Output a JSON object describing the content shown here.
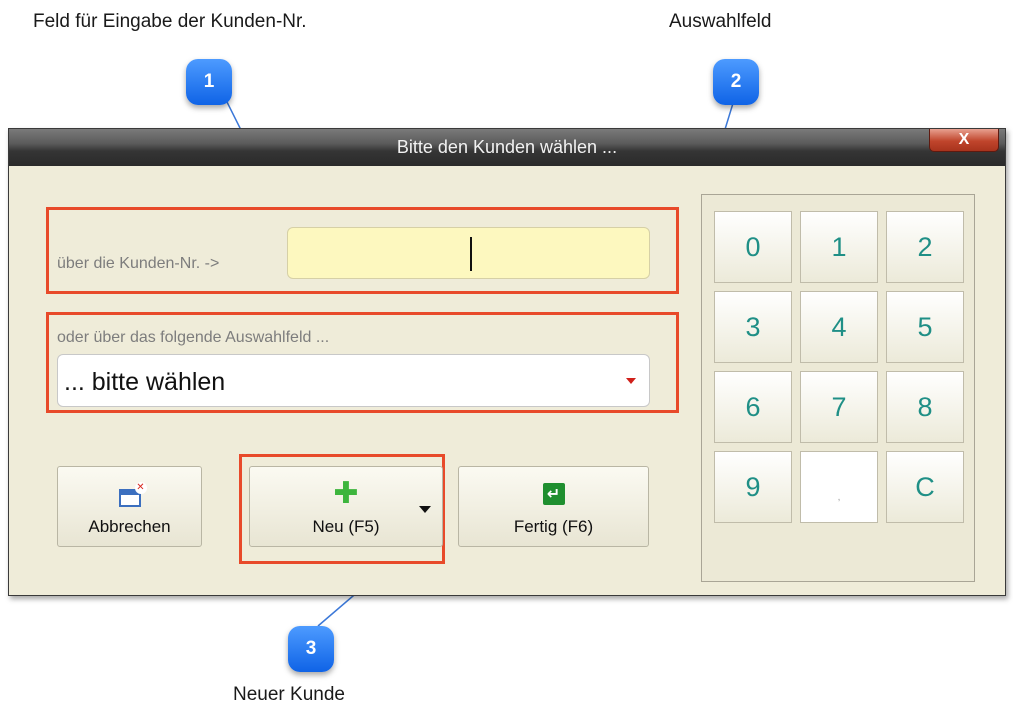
{
  "callouts": [
    {
      "number": "1",
      "label": "Feld für Eingabe der Kunden-Nr."
    },
    {
      "number": "2",
      "label": "Auswahlfeld"
    },
    {
      "number": "3",
      "label": "Neuer Kunde"
    }
  ],
  "window": {
    "title": "Bitte den Kunden wählen ...",
    "close_label": "X"
  },
  "customer_number": {
    "label": "über die Kunden-Nr. ->",
    "value": ""
  },
  "selection": {
    "label": "oder über das folgende Auswahlfeld ...",
    "selected": "... bitte wählen"
  },
  "buttons": {
    "cancel": "Abbrechen",
    "new": "Neu (F5)",
    "done": "Fertig (F6)"
  },
  "numpad": {
    "keys": [
      "0",
      "1",
      "2",
      "3",
      "4",
      "5",
      "6",
      "7",
      "8",
      "9",
      ",",
      "C"
    ]
  },
  "colors": {
    "highlight_frame": "#e84a2a",
    "callout_bubble": "#1c6ff0",
    "input_background": "#fdf8bf",
    "numpad_digits": "#1f8f86"
  }
}
